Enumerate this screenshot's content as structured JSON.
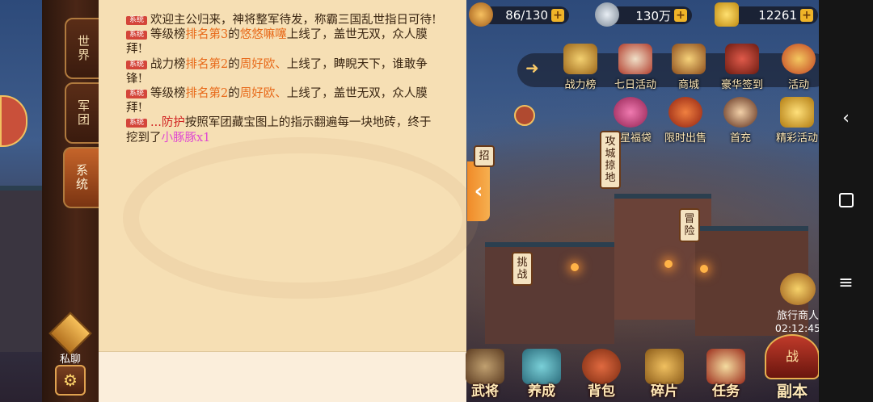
{
  "tabs": [
    {
      "label": "世界"
    },
    {
      "label": "军团"
    },
    {
      "label": "系统"
    }
  ],
  "messages": [
    {
      "badge": "系统",
      "parts": [
        {
          "t": "欢迎主公归来，神将整军待发，称霸三国乱世指日可待!",
          "c": ""
        }
      ]
    },
    {
      "badge": "系统",
      "parts": [
        {
          "t": "等级榜",
          "c": ""
        },
        {
          "t": "排名第3",
          "c": "hl"
        },
        {
          "t": "的",
          "c": ""
        },
        {
          "t": "悠悠嘛噻",
          "c": "hl"
        },
        {
          "t": "上线了，盖世无双，众人膜拜!",
          "c": ""
        }
      ]
    },
    {
      "badge": "系统",
      "parts": [
        {
          "t": "战力榜",
          "c": ""
        },
        {
          "t": "排名第2",
          "c": "hl"
        },
        {
          "t": "的",
          "c": ""
        },
        {
          "t": "周好欧、",
          "c": "hl"
        },
        {
          "t": "上线了，睥睨天下，谁敢争锋!",
          "c": ""
        }
      ]
    },
    {
      "badge": "系统",
      "parts": [
        {
          "t": "等级榜",
          "c": ""
        },
        {
          "t": "排名第2",
          "c": "hl"
        },
        {
          "t": "的",
          "c": ""
        },
        {
          "t": "周好欧、",
          "c": "hl"
        },
        {
          "t": "上线了，盖世无双，众人膜拜!",
          "c": ""
        }
      ]
    },
    {
      "badge": "系统",
      "parts": [
        {
          "t": "...防护",
          "c": "red"
        },
        {
          "t": "按照军团藏宝图上的指示翻遍每一块地砖，终于挖到了",
          "c": ""
        },
        {
          "t": "小豚豚x1",
          "c": "pink"
        }
      ]
    }
  ],
  "side": {
    "private_chat": "私聊"
  },
  "resources": {
    "stamina": "86/130",
    "silver": "130万",
    "gold": "12261"
  },
  "activities": [
    "战力榜",
    "七日活动",
    "商城",
    "豪华签到",
    "活动",
    "明星福袋",
    "限时出售",
    "首充",
    "精彩活动"
  ],
  "map_tags": {
    "siege": "攻城掠地",
    "adventure": "冒险",
    "challenge": "挑战",
    "recruit": "招"
  },
  "merchant": {
    "label": "旅行商人",
    "timer": "02:12:45"
  },
  "bottom": [
    "武将",
    "养成",
    "背包",
    "碎片",
    "任务"
  ],
  "dungeon": {
    "label": "副本",
    "badge": "战"
  },
  "colors": {
    "panel": "#f6dfb4",
    "highlight": "#e86a1a",
    "item": "#e04ad2",
    "badge": "#d4453a"
  }
}
